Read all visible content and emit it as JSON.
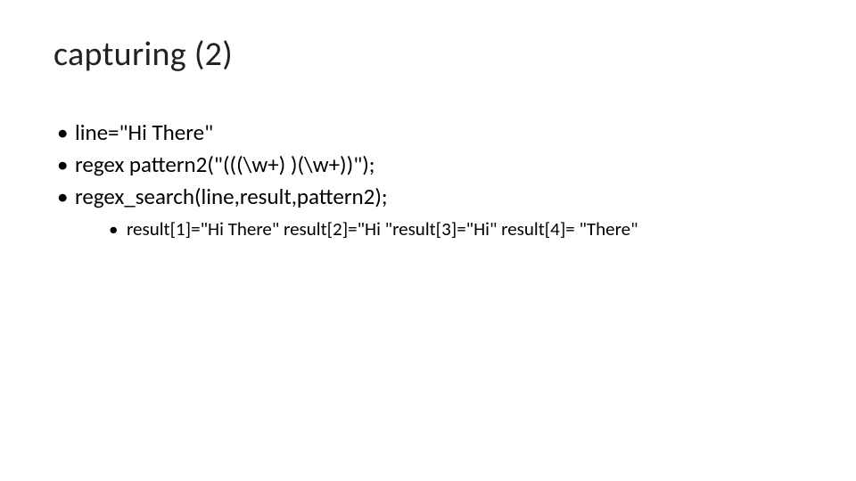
{
  "title": "capturing (2)",
  "bullets": {
    "b1": "line=\"Hi There\"",
    "b2": "regex pattern2(\"(((\\w+) )(\\w+))\");",
    "b3": "regex_search(line,result,pattern2);",
    "sub1": "result[1]=\"Hi There\" result[2]=\"Hi \"result[3]=\"Hi\" result[4]= \"There\""
  }
}
